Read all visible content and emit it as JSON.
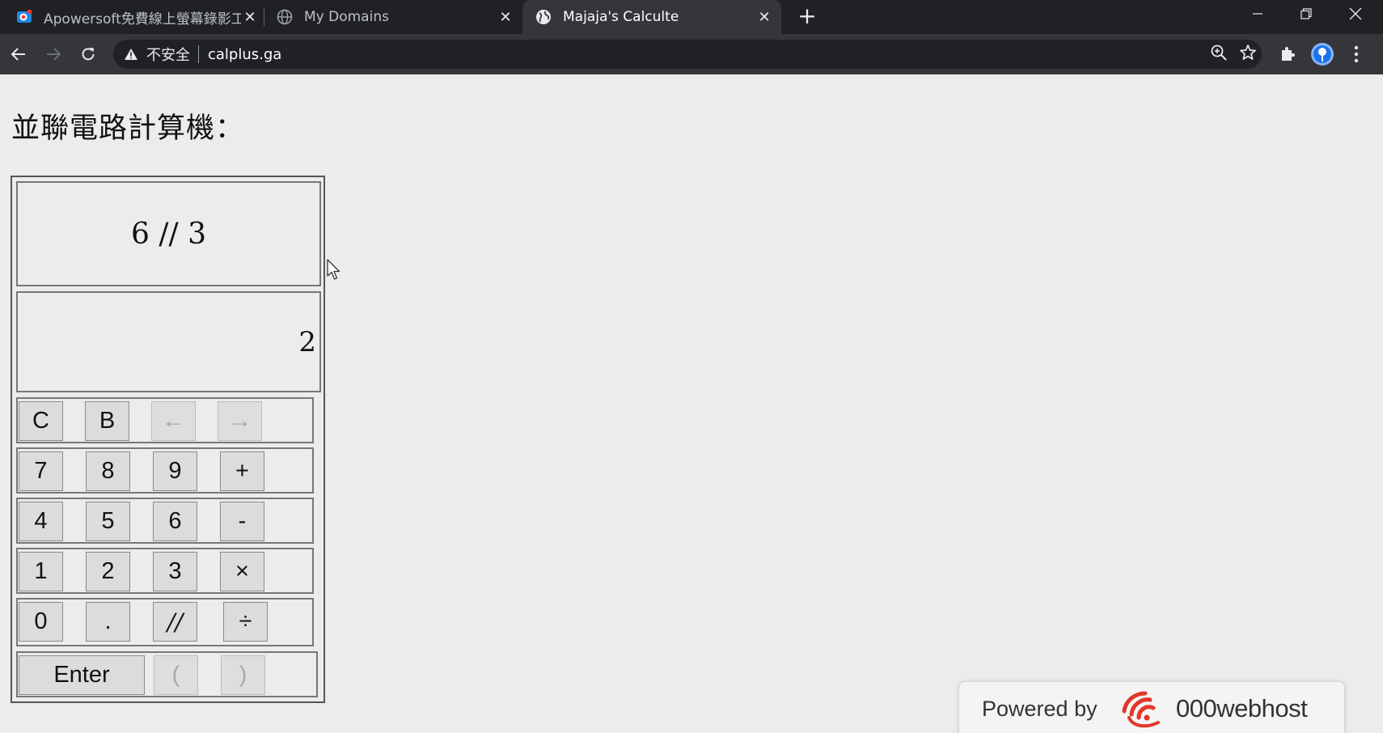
{
  "browser": {
    "tabs": [
      {
        "title": "Apowersoft免費線上螢幕錄影工",
        "icon": "apowersoft-icon",
        "active": false
      },
      {
        "title": "My Domains",
        "icon": "globe-icon",
        "active": false
      },
      {
        "title": "Majaja's Calculte",
        "icon": "globe-icon",
        "active": true
      }
    ],
    "security_label": "不安全",
    "url": "calplus.ga"
  },
  "page": {
    "heading": "並聯電路計算機："
  },
  "calculator": {
    "expression": "6 // 3",
    "result": "2",
    "rows": [
      [
        {
          "label": "C",
          "enabled": true
        },
        {
          "label": "B",
          "enabled": true
        },
        {
          "label": "←",
          "enabled": false
        },
        {
          "label": "→",
          "enabled": false
        }
      ],
      [
        {
          "label": "7",
          "enabled": true
        },
        {
          "label": "8",
          "enabled": true
        },
        {
          "label": "9",
          "enabled": true
        },
        {
          "label": "+",
          "enabled": true
        }
      ],
      [
        {
          "label": "4",
          "enabled": true
        },
        {
          "label": "5",
          "enabled": true
        },
        {
          "label": "6",
          "enabled": true
        },
        {
          "label": "-",
          "enabled": true
        }
      ],
      [
        {
          "label": "1",
          "enabled": true
        },
        {
          "label": "2",
          "enabled": true
        },
        {
          "label": "3",
          "enabled": true
        },
        {
          "label": "×",
          "enabled": true
        }
      ],
      [
        {
          "label": "0",
          "enabled": true
        },
        {
          "label": ".",
          "enabled": true
        },
        {
          "label": "//",
          "enabled": true
        },
        {
          "label": "÷",
          "enabled": true
        }
      ],
      [
        {
          "label": "Enter",
          "enabled": true
        },
        {
          "label": "(",
          "enabled": false
        },
        {
          "label": ")",
          "enabled": false
        }
      ]
    ]
  },
  "badge": {
    "powered_by": "Powered by",
    "brand": "000webhost"
  },
  "colors": {
    "tabbar_bg": "#202124",
    "toolbar_bg": "#35363a",
    "page_bg": "#ececec",
    "key_bg": "#dcdcdc",
    "brand_red": "#e1372b"
  }
}
